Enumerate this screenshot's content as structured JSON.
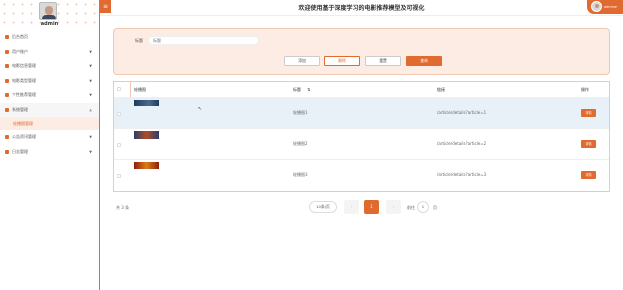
{
  "sidebar": {
    "username": "admin",
    "items": [
      {
        "label": "后台首页",
        "icon": "home-icon",
        "has_arrow": false
      },
      {
        "label": "用户账户",
        "icon": "user-icon",
        "has_arrow": true
      },
      {
        "label": "电影信息管理",
        "icon": "film-icon",
        "has_arrow": true
      },
      {
        "label": "电影类型管理",
        "icon": "tag-icon",
        "has_arrow": true
      },
      {
        "label": "个性推荐管理",
        "icon": "star-icon",
        "has_arrow": true
      },
      {
        "label": "系统管理",
        "icon": "settings-icon",
        "has_arrow": true,
        "open": true
      },
      {
        "label": "公告资讯管理",
        "icon": "notice-icon",
        "has_arrow": true
      },
      {
        "label": "日志管理",
        "icon": "log-icon",
        "has_arrow": true
      }
    ],
    "submenu": {
      "label": "轮播图管理"
    }
  },
  "header": {
    "title": "欢迎使用基于深度学习的电影推荐模型及可视化",
    "menu_icon": "≡",
    "user_label": "admin"
  },
  "search": {
    "label": "标题",
    "placeholder": "标题",
    "buttons": {
      "add": "添加",
      "delete": "删除",
      "reset": "重置",
      "query": "查询"
    }
  },
  "table": {
    "columns": [
      "轮播图",
      "标题",
      "链接",
      "操作"
    ],
    "rows": [
      {
        "title": "轮播图1",
        "link": "/article/details?article=1",
        "action": "详情",
        "thumb_colors": [
          "#1f3c5a",
          "#4a6a8e"
        ]
      },
      {
        "title": "轮播图2",
        "link": "/article/details?article=2",
        "action": "详情",
        "thumb_colors": [
          "#2b3d6a",
          "#b04f2a"
        ]
      },
      {
        "title": "轮播图3",
        "link": "/article/details?article=3",
        "action": "详情",
        "thumb_colors": [
          "#8a1f0c",
          "#e07b1a"
        ]
      }
    ]
  },
  "pagination": {
    "total": "共 3 条",
    "page_size": "10条/页",
    "prev": "‹",
    "current": "1",
    "next": "›",
    "goto_prefix": "前往",
    "goto_value": "1",
    "goto_suffix": "页"
  },
  "colors": {
    "accent": "#e06a2f",
    "panel_bg": "#fdece3",
    "row_highlight": "#e9f1f8"
  }
}
